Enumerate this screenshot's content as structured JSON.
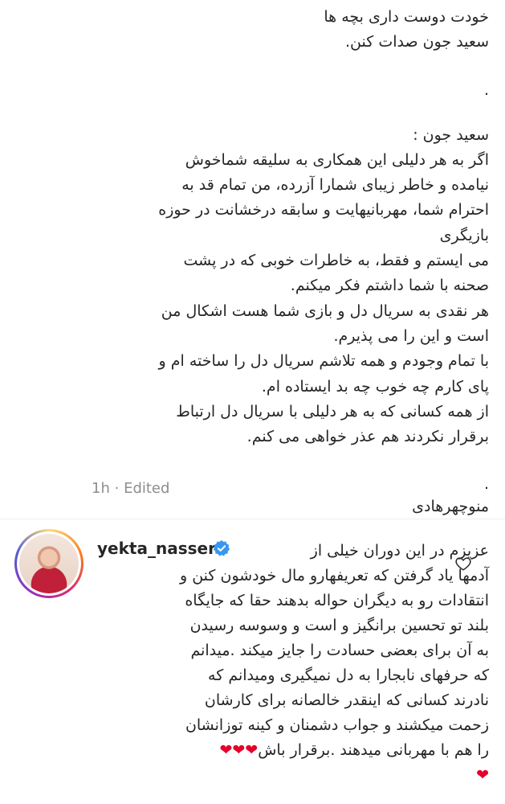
{
  "post": {
    "caption_lines": [
      "خودت دوست داری بچه ها",
      "سعید جون صدات کنن.",
      "",
      ".",
      "",
      "سعید جون :",
      "اگر به هر دلیلی این همکاری به سلیقه شماخوش",
      "نیامده و خاطر زیبای شمارا آزرده، من تمام قد به",
      "احترام شما، مهربانیهایت و سابقه درخشانت در حوزه",
      "بازیگری",
      "می ایستم و فقط، به خاطرات خوبی که در پشت",
      "صحنه با شما داشتم فکر میکنم.",
      "هر نقدی به سریال دل و بازی شما هست اشکال من",
      "است و این را می پذیرم.",
      "با تمام وجودم و همه تلاشم سریال دل را ساخته ام و",
      "پای کارم چه خوب چه بد ایستاده ام.",
      "از همه کسانی که به هر دلیلی با سریال دل ارتباط",
      "برقرار نکردند هم عذر خواهی می کنم.",
      "",
      ".",
      "منوچهرهادی"
    ],
    "timestamp": "1h",
    "separator": "·",
    "edited_label": "Edited"
  },
  "comment": {
    "username": "yekta_nasser",
    "verified": true,
    "text_lines": [
      "عزیزم در این دوران خیلی از",
      "آدمها یاد گرفتن که تعریفهارو مال خودشون کنن و",
      "انتقادات رو به دیگران حواله بدهند حقا که جایگاه",
      "بلند تو تحسین برانگیز و است و وسوسه رسیدن",
      "به آن برای بعضی حسادت را جایز میکند .میدانم",
      "که حرفهای نابجارا به دل نمیگیری ومیدانم که",
      "نادرند کسانی که اینقدر خالصانه برای کارشان",
      "زحمت میکشند و جواب دشمنان و کینه توزانشان",
      "را هم با مهربانی میدهند .برقرار باش",
      ""
    ],
    "hearts_inline": "❤❤❤",
    "heart_trailing": "❤"
  },
  "icons": {
    "verified": "verified-badge-icon",
    "like": "heart-outline-icon",
    "verified_color": "#3897f0",
    "heart_color": "#e3002b",
    "muted_color": "#8e8e8e"
  }
}
